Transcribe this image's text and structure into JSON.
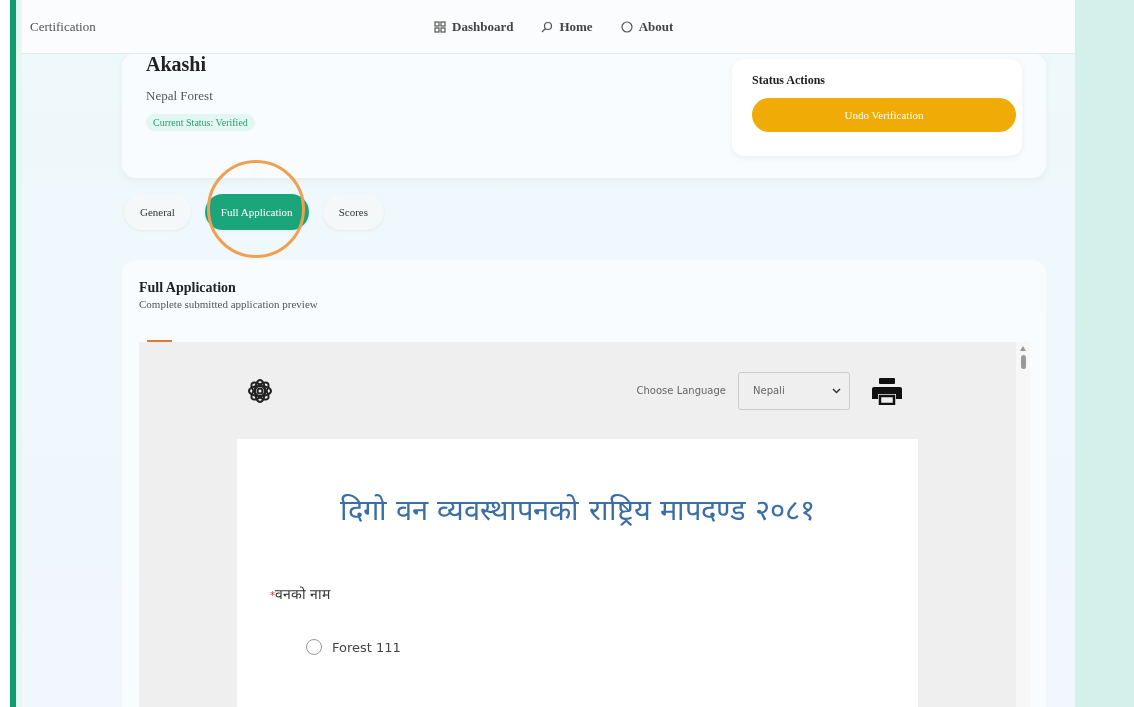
{
  "header": {
    "brand": "Certification",
    "nav": [
      {
        "label": "Dashboard"
      },
      {
        "label": "Home"
      },
      {
        "label": "About"
      }
    ]
  },
  "profile": {
    "name": "Akashi",
    "organization": "Nepal Forest",
    "status_label": "Current Status:",
    "status_value": "Verified"
  },
  "status_actions": {
    "title": "Status Actions",
    "button": "Undo Verification"
  },
  "tabs": [
    {
      "label": "General",
      "selected": false
    },
    {
      "label": "Full Application",
      "selected": true
    },
    {
      "label": "Scores",
      "selected": false
    }
  ],
  "panel": {
    "title": "Full Application",
    "subtitle": "Complete submitted application preview"
  },
  "preview": {
    "language_label": "Choose Language",
    "language_value": "Nepali",
    "form_title": "दिगो वन व्यवस्थापनको राष्ट्रिय मापदण्ड २०८१",
    "question": "वनको नाम",
    "required_mark": "*",
    "options": [
      {
        "label": "Forest 111",
        "selected": false
      }
    ]
  }
}
